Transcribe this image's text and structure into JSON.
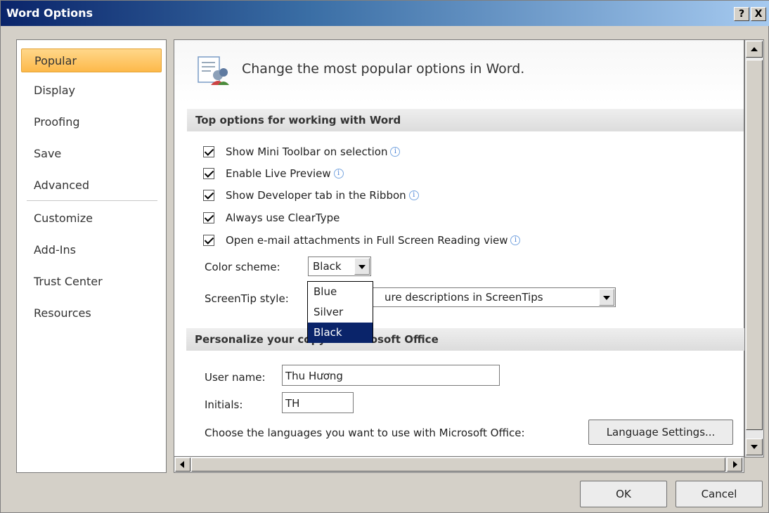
{
  "window": {
    "title": "Word Options",
    "help_label": "?",
    "close_label": "X"
  },
  "nav": {
    "items": [
      {
        "label": "Popular",
        "selected": true
      },
      {
        "label": "Display"
      },
      {
        "label": "Proofing"
      },
      {
        "label": "Save"
      },
      {
        "label": "Advanced"
      },
      {
        "label": "Customize"
      },
      {
        "label": "Add-Ins"
      },
      {
        "label": "Trust Center"
      },
      {
        "label": "Resources"
      }
    ]
  },
  "header": {
    "title": "Change the most popular options in Word.",
    "icon": "popular-options-icon"
  },
  "sections": {
    "top_options": "Top options for working with Word",
    "personalize": "Personalize your copy of Microsoft Office"
  },
  "options": [
    {
      "label": "Show Mini Toolbar on selection",
      "checked": true,
      "info": true
    },
    {
      "label": "Enable Live Preview",
      "checked": true,
      "info": true
    },
    {
      "label": "Show Developer tab in the Ribbon",
      "checked": true,
      "info": true
    },
    {
      "label": "Always use ClearType",
      "checked": true,
      "info": false
    },
    {
      "label": "Open e-mail attachments in Full Screen Reading view",
      "checked": true,
      "info": true
    }
  ],
  "color_scheme": {
    "label": "Color scheme:",
    "value": "Black",
    "options": [
      "Blue",
      "Silver",
      "Black"
    ]
  },
  "screentip": {
    "label": "ScreenTip style:",
    "value": "Show feature descriptions in ScreenTips",
    "visible_value": "ure descriptions in ScreenTips"
  },
  "personalize": {
    "user_name_label": "User name:",
    "user_name_value": "Thu Hương",
    "initials_label": "Initials:",
    "initials_value": "TH",
    "languages_text": "Choose the languages you want to use with Microsoft Office:",
    "language_settings_label": "Language Settings..."
  },
  "footer": {
    "ok_label": "OK",
    "cancel_label": "Cancel"
  },
  "colors": {
    "selected_nav": "#fdb94a",
    "dropdown_highlight": "#0a246a",
    "titlebar": "#0a246a"
  }
}
